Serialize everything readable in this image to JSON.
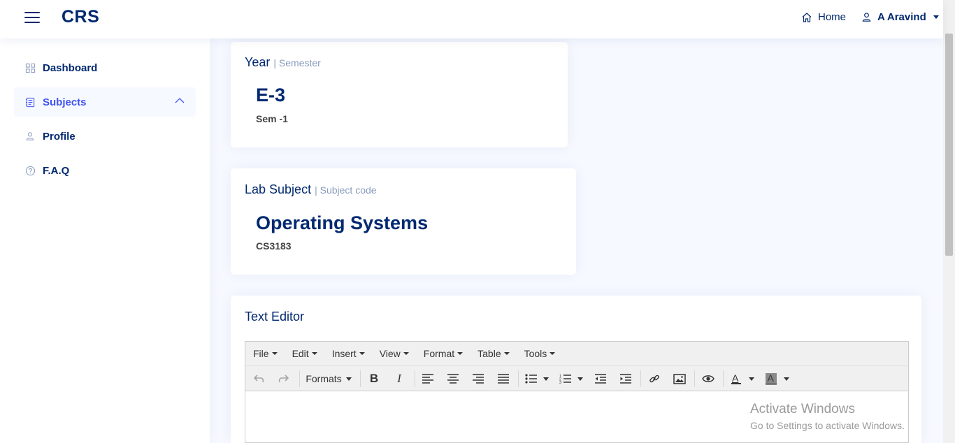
{
  "header": {
    "brand": "CRS",
    "home_label": "Home",
    "user_name": "A Aravind"
  },
  "sidebar": {
    "items": [
      {
        "label": "Dashboard",
        "icon": "grid-icon"
      },
      {
        "label": "Subjects",
        "icon": "journal-icon",
        "active": true
      },
      {
        "label": "Profile",
        "icon": "person-icon"
      },
      {
        "label": "F.A.Q",
        "icon": "question-circle-icon"
      }
    ]
  },
  "year_card": {
    "title": "Year",
    "subtitle": "| Semester",
    "value": "E-3",
    "detail": "Sem -1"
  },
  "lab_card": {
    "title": "Lab Subject",
    "subtitle": "| Subject code",
    "value": "Operating Systems",
    "detail": "CS3183"
  },
  "editor_card": {
    "title": "Text Editor",
    "menus": [
      "File",
      "Edit",
      "Insert",
      "View",
      "Format",
      "Table",
      "Tools"
    ],
    "formats_label": "Formats"
  },
  "watermark": {
    "line1": "Activate Windows",
    "line2": "Go to Settings to activate Windows."
  },
  "colors": {
    "primary": "#012970",
    "accent": "#4154f1",
    "muted": "#899bbd",
    "background": "#f6f9ff"
  }
}
